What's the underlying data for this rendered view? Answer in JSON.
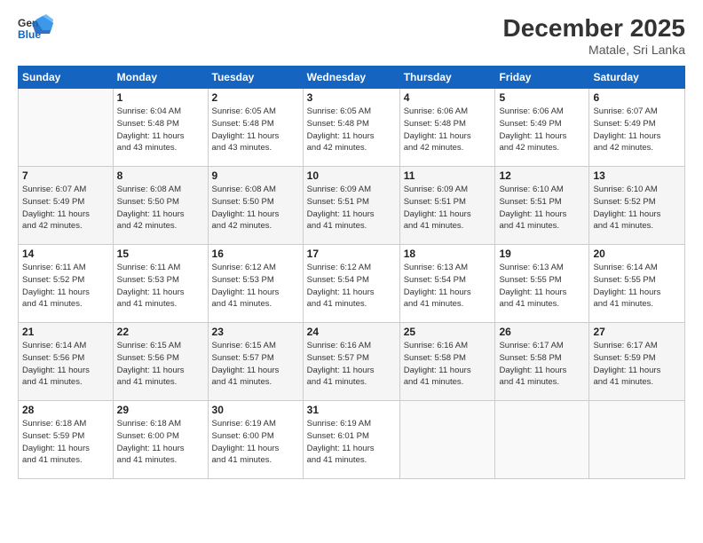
{
  "header": {
    "logo_general": "General",
    "logo_blue": "Blue",
    "title": "December 2025",
    "location": "Matale, Sri Lanka"
  },
  "days_of_week": [
    "Sunday",
    "Monday",
    "Tuesday",
    "Wednesday",
    "Thursday",
    "Friday",
    "Saturday"
  ],
  "weeks": [
    [
      {
        "day": "",
        "info": ""
      },
      {
        "day": "1",
        "info": "Sunrise: 6:04 AM\nSunset: 5:48 PM\nDaylight: 11 hours\nand 43 minutes."
      },
      {
        "day": "2",
        "info": "Sunrise: 6:05 AM\nSunset: 5:48 PM\nDaylight: 11 hours\nand 43 minutes."
      },
      {
        "day": "3",
        "info": "Sunrise: 6:05 AM\nSunset: 5:48 PM\nDaylight: 11 hours\nand 42 minutes."
      },
      {
        "day": "4",
        "info": "Sunrise: 6:06 AM\nSunset: 5:48 PM\nDaylight: 11 hours\nand 42 minutes."
      },
      {
        "day": "5",
        "info": "Sunrise: 6:06 AM\nSunset: 5:49 PM\nDaylight: 11 hours\nand 42 minutes."
      },
      {
        "day": "6",
        "info": "Sunrise: 6:07 AM\nSunset: 5:49 PM\nDaylight: 11 hours\nand 42 minutes."
      }
    ],
    [
      {
        "day": "7",
        "info": "Sunrise: 6:07 AM\nSunset: 5:49 PM\nDaylight: 11 hours\nand 42 minutes."
      },
      {
        "day": "8",
        "info": "Sunrise: 6:08 AM\nSunset: 5:50 PM\nDaylight: 11 hours\nand 42 minutes."
      },
      {
        "day": "9",
        "info": "Sunrise: 6:08 AM\nSunset: 5:50 PM\nDaylight: 11 hours\nand 42 minutes."
      },
      {
        "day": "10",
        "info": "Sunrise: 6:09 AM\nSunset: 5:51 PM\nDaylight: 11 hours\nand 41 minutes."
      },
      {
        "day": "11",
        "info": "Sunrise: 6:09 AM\nSunset: 5:51 PM\nDaylight: 11 hours\nand 41 minutes."
      },
      {
        "day": "12",
        "info": "Sunrise: 6:10 AM\nSunset: 5:51 PM\nDaylight: 11 hours\nand 41 minutes."
      },
      {
        "day": "13",
        "info": "Sunrise: 6:10 AM\nSunset: 5:52 PM\nDaylight: 11 hours\nand 41 minutes."
      }
    ],
    [
      {
        "day": "14",
        "info": "Sunrise: 6:11 AM\nSunset: 5:52 PM\nDaylight: 11 hours\nand 41 minutes."
      },
      {
        "day": "15",
        "info": "Sunrise: 6:11 AM\nSunset: 5:53 PM\nDaylight: 11 hours\nand 41 minutes."
      },
      {
        "day": "16",
        "info": "Sunrise: 6:12 AM\nSunset: 5:53 PM\nDaylight: 11 hours\nand 41 minutes."
      },
      {
        "day": "17",
        "info": "Sunrise: 6:12 AM\nSunset: 5:54 PM\nDaylight: 11 hours\nand 41 minutes."
      },
      {
        "day": "18",
        "info": "Sunrise: 6:13 AM\nSunset: 5:54 PM\nDaylight: 11 hours\nand 41 minutes."
      },
      {
        "day": "19",
        "info": "Sunrise: 6:13 AM\nSunset: 5:55 PM\nDaylight: 11 hours\nand 41 minutes."
      },
      {
        "day": "20",
        "info": "Sunrise: 6:14 AM\nSunset: 5:55 PM\nDaylight: 11 hours\nand 41 minutes."
      }
    ],
    [
      {
        "day": "21",
        "info": "Sunrise: 6:14 AM\nSunset: 5:56 PM\nDaylight: 11 hours\nand 41 minutes."
      },
      {
        "day": "22",
        "info": "Sunrise: 6:15 AM\nSunset: 5:56 PM\nDaylight: 11 hours\nand 41 minutes."
      },
      {
        "day": "23",
        "info": "Sunrise: 6:15 AM\nSunset: 5:57 PM\nDaylight: 11 hours\nand 41 minutes."
      },
      {
        "day": "24",
        "info": "Sunrise: 6:16 AM\nSunset: 5:57 PM\nDaylight: 11 hours\nand 41 minutes."
      },
      {
        "day": "25",
        "info": "Sunrise: 6:16 AM\nSunset: 5:58 PM\nDaylight: 11 hours\nand 41 minutes."
      },
      {
        "day": "26",
        "info": "Sunrise: 6:17 AM\nSunset: 5:58 PM\nDaylight: 11 hours\nand 41 minutes."
      },
      {
        "day": "27",
        "info": "Sunrise: 6:17 AM\nSunset: 5:59 PM\nDaylight: 11 hours\nand 41 minutes."
      }
    ],
    [
      {
        "day": "28",
        "info": "Sunrise: 6:18 AM\nSunset: 5:59 PM\nDaylight: 11 hours\nand 41 minutes."
      },
      {
        "day": "29",
        "info": "Sunrise: 6:18 AM\nSunset: 6:00 PM\nDaylight: 11 hours\nand 41 minutes."
      },
      {
        "day": "30",
        "info": "Sunrise: 6:19 AM\nSunset: 6:00 PM\nDaylight: 11 hours\nand 41 minutes."
      },
      {
        "day": "31",
        "info": "Sunrise: 6:19 AM\nSunset: 6:01 PM\nDaylight: 11 hours\nand 41 minutes."
      },
      {
        "day": "",
        "info": ""
      },
      {
        "day": "",
        "info": ""
      },
      {
        "day": "",
        "info": ""
      }
    ]
  ]
}
